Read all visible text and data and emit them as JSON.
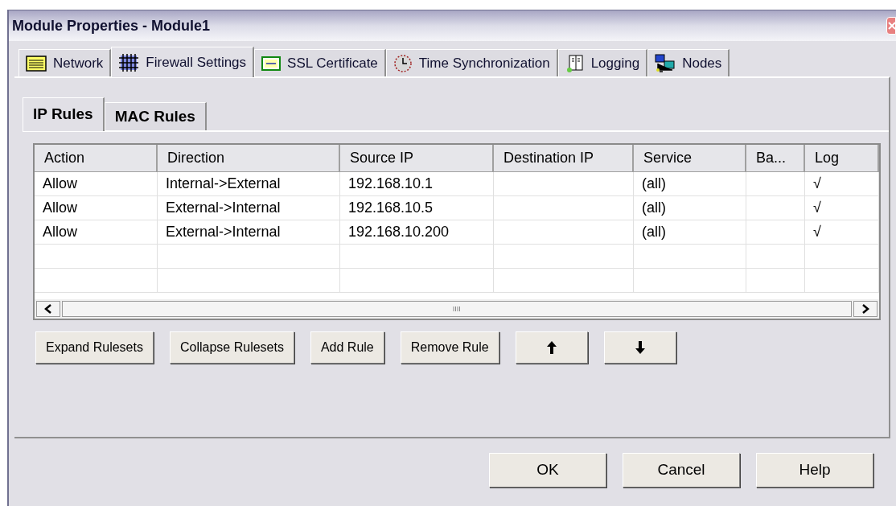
{
  "window": {
    "title": "Module Properties - Module1"
  },
  "tabs": [
    {
      "label": "Network",
      "selected": false
    },
    {
      "label": "Firewall Settings",
      "selected": true
    },
    {
      "label": "SSL Certificate",
      "selected": false
    },
    {
      "label": "Time Synchronization",
      "selected": false
    },
    {
      "label": "Logging",
      "selected": false
    },
    {
      "label": "Nodes",
      "selected": false
    }
  ],
  "subtabs": [
    {
      "label": "IP Rules",
      "selected": true
    },
    {
      "label": "MAC Rules",
      "selected": false
    }
  ],
  "table": {
    "columns": [
      "Action",
      "Direction",
      "Source IP",
      "Destination IP",
      "Service",
      "Ba...",
      "Log"
    ],
    "rows": [
      [
        "Allow",
        "Internal->External",
        "192.168.10.1",
        "",
        "(all)",
        "",
        "√"
      ],
      [
        "Allow",
        "External->Internal",
        "192.168.10.5",
        "",
        "(all)",
        "",
        "√"
      ],
      [
        "Allow",
        "External->Internal",
        "192.168.10.200",
        "",
        "(all)",
        "",
        "√"
      ]
    ]
  },
  "rule_buttons": [
    {
      "kind": "text",
      "label": "Expand Rulesets"
    },
    {
      "kind": "text",
      "label": "Collapse Rulesets"
    },
    {
      "kind": "text",
      "label": "Add Rule"
    },
    {
      "kind": "text",
      "label": "Remove Rule"
    },
    {
      "kind": "up"
    },
    {
      "kind": "down"
    }
  ],
  "dialog_buttons": [
    "OK",
    "Cancel",
    "Help"
  ]
}
